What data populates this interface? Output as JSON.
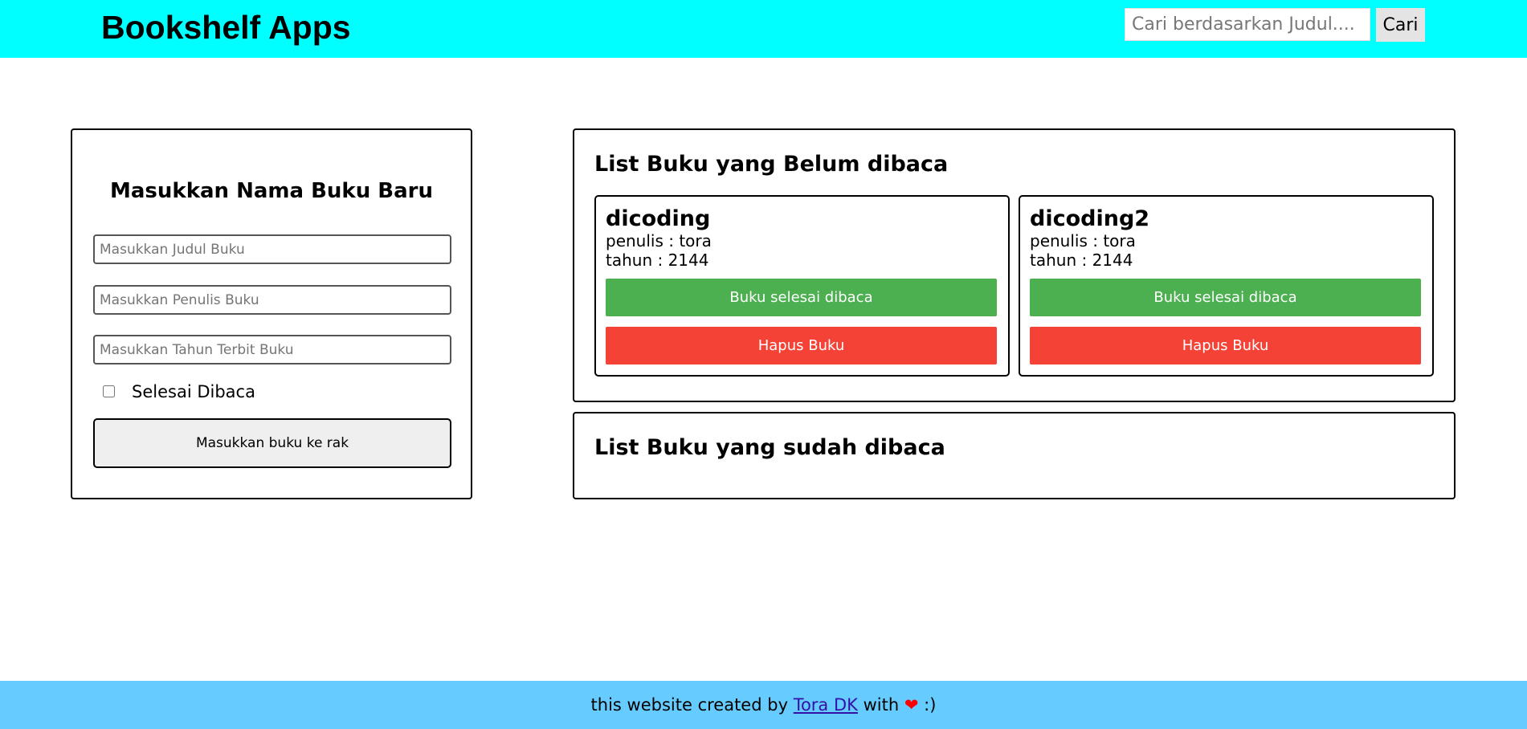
{
  "header": {
    "title": "Bookshelf Apps",
    "search_placeholder": "Cari berdasarkan Judul....",
    "search_button": "Cari"
  },
  "form": {
    "title": "Masukkan Nama Buku Baru",
    "title_placeholder": "Masukkan Judul Buku",
    "author_placeholder": "Masukkan Penulis Buku",
    "year_placeholder": "Masukkan Tahun Terbit Buku",
    "checkbox_label": "Selesai Dibaca",
    "checkbox_checked": false,
    "submit_label": "Masukkan buku ke rak"
  },
  "unread_shelf": {
    "title": "List Buku yang Belum dibaca",
    "books": [
      {
        "title": "dicoding",
        "author": "penulis : tora",
        "year": "tahun : 2144",
        "done_label": "Buku selesai dibaca",
        "delete_label": "Hapus Buku"
      },
      {
        "title": "dicoding2",
        "author": "penulis : tora",
        "year": "tahun : 2144",
        "done_label": "Buku selesai dibaca",
        "delete_label": "Hapus Buku"
      }
    ]
  },
  "read_shelf": {
    "title": "List Buku yang sudah dibaca"
  },
  "footer": {
    "prefix": "this website created by",
    "author_link": "Tora DK",
    "middle": "with",
    "suffix": ":)"
  },
  "colors": {
    "header_bg": "#00ffff",
    "footer_bg": "#66ccff",
    "done_button": "#4caf50",
    "delete_button": "#f44336",
    "heart": "#ff0000"
  },
  "icons": {
    "footer_heart": "heart-icon"
  }
}
